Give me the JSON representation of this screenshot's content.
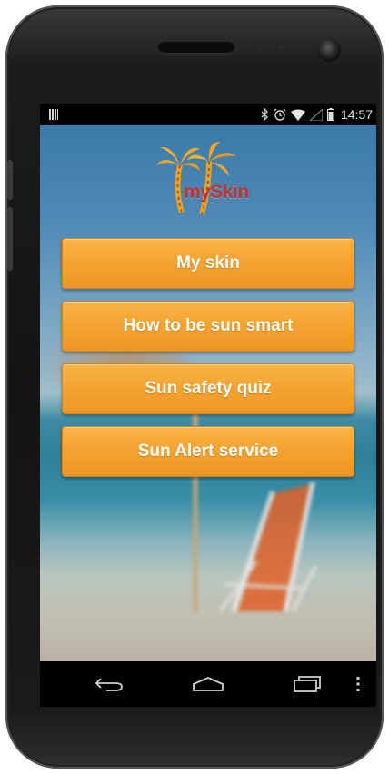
{
  "status_bar": {
    "time": "14:57",
    "icons": [
      "bluetooth-icon",
      "alarm-icon",
      "wifi-icon",
      "signal-icon",
      "battery-icon"
    ]
  },
  "app": {
    "logo_text": "mySkin",
    "menu": [
      {
        "label": "My skin"
      },
      {
        "label": "How to be sun smart"
      },
      {
        "label": "Sun safety quiz"
      },
      {
        "label": "Sun Alert service"
      }
    ],
    "colors": {
      "button": "#f4a433",
      "button_border": "#d9831c",
      "logo_text": "#c2332b"
    }
  },
  "nav_bar": {
    "buttons": [
      "back-icon",
      "home-icon",
      "recent-apps-icon",
      "overflow-menu-icon"
    ]
  }
}
